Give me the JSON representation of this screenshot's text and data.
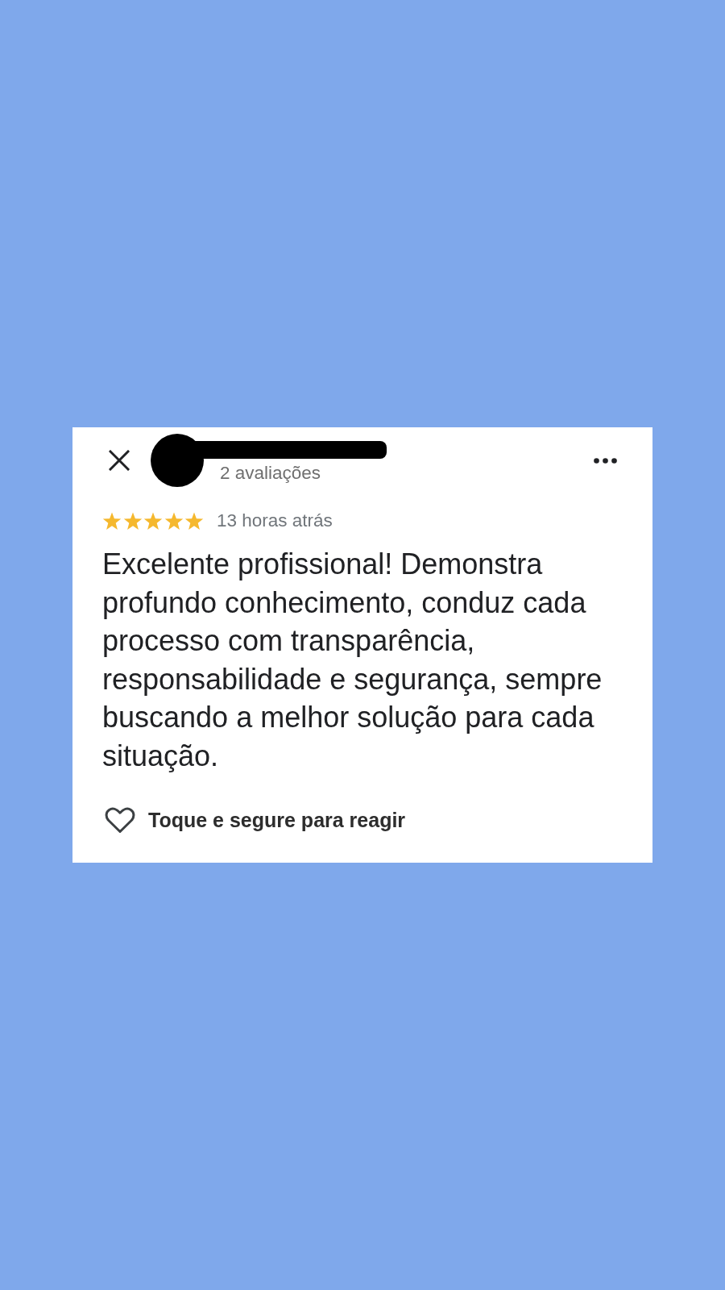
{
  "review": {
    "reviewer_reviews": "2 avaliações",
    "stars": 5,
    "time": "13 horas atrás",
    "text": "Excelente profissional! Demonstra profundo conhecimento, conduz cada processo com transparência, responsabilidade e segurança, sempre buscando a melhor solução para cada situação.",
    "reaction_hint": "Toque e segure para reagir"
  }
}
